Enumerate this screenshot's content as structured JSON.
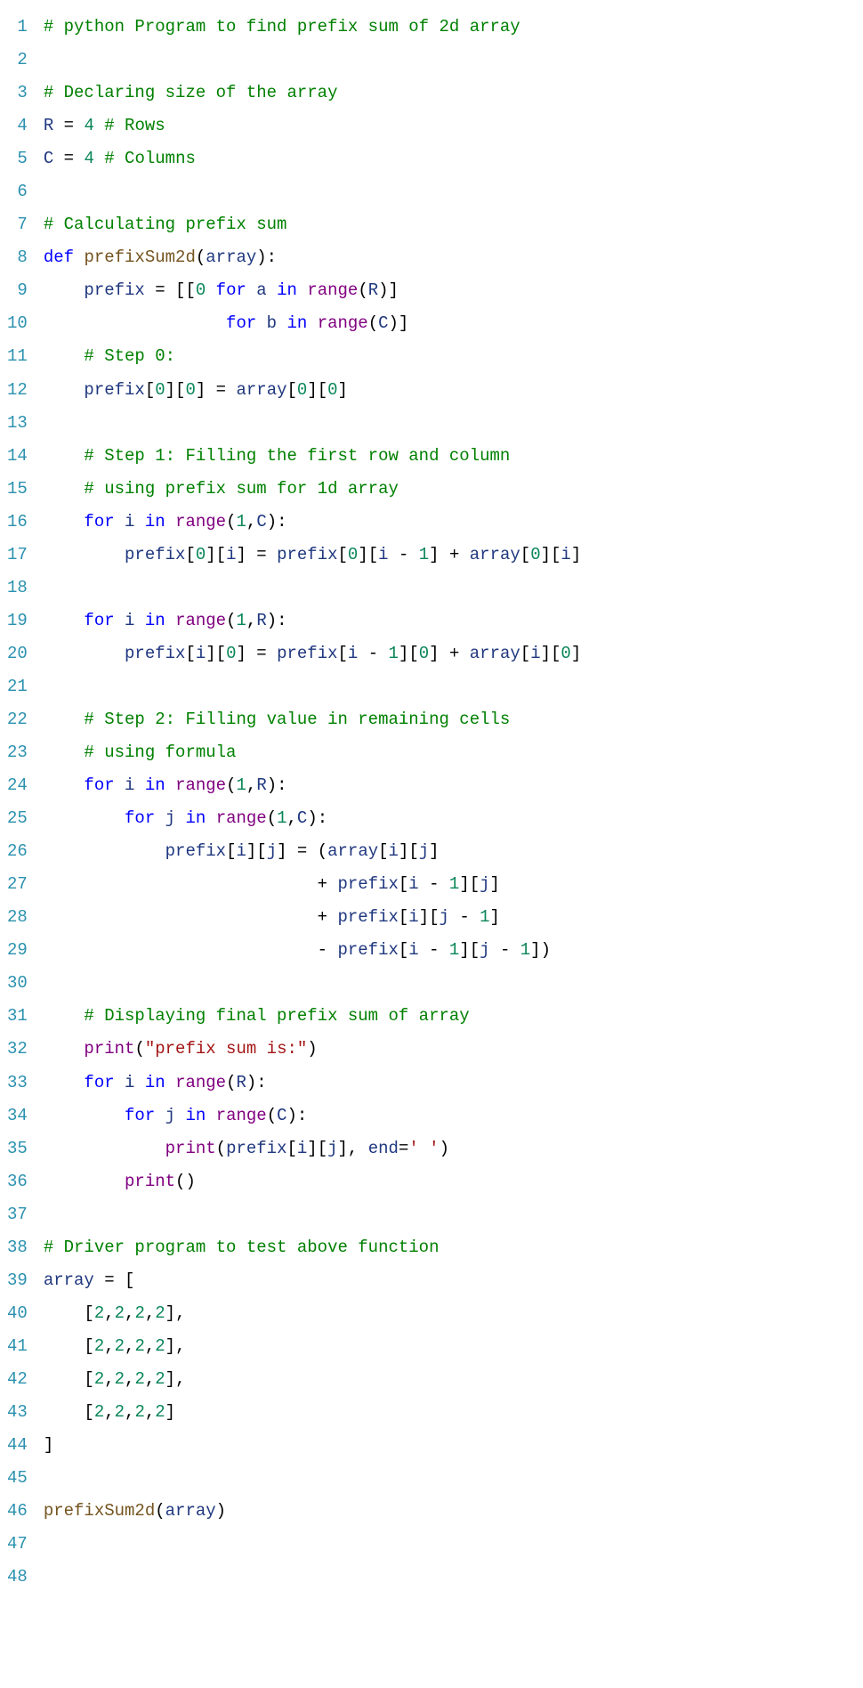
{
  "language": "python",
  "colors": {
    "comment": "#008000",
    "keyword": "#0000ff",
    "name": "#1f377f",
    "func": "#74531f",
    "number": "#098658",
    "builtin": "#800080",
    "string": "#a31515",
    "gutter": "#2b91af"
  },
  "line_count": 48,
  "code_lines": [
    "# python Program to find prefix sum of 2d array",
    "",
    "# Declaring size of the array",
    "R = 4 # Rows",
    "C = 4 # Columns",
    "",
    "# Calculating prefix sum",
    "def prefixSum2d(array):",
    "    prefix = [[0 for a in range(R)]",
    "                  for b in range(C)]",
    "    # Step 0:",
    "    prefix[0][0] = array[0][0]",
    "",
    "    # Step 1: Filling the first row and column",
    "    # using prefix sum for 1d array",
    "    for i in range(1,C):",
    "        prefix[0][i] = prefix[0][i - 1] + array[0][i]",
    "",
    "    for i in range(1,R):",
    "        prefix[i][0] = prefix[i - 1][0] + array[i][0]",
    "",
    "    # Step 2: Filling value in remaining cells",
    "    # using formula",
    "    for i in range(1,R):",
    "        for j in range(1,C):",
    "            prefix[i][j] = (array[i][j]",
    "                           + prefix[i - 1][j]",
    "                           + prefix[i][j - 1]",
    "                           - prefix[i - 1][j - 1])",
    "",
    "    # Displaying final prefix sum of array",
    "    print(\"prefix sum is:\")",
    "    for i in range(R):",
    "        for j in range(C):",
    "            print(prefix[i][j], end=' ')",
    "        print()",
    "",
    "# Driver program to test above function",
    "array = [",
    "    [2,2,2,2],",
    "    [2,2,2,2],",
    "    [2,2,2,2],",
    "    [2,2,2,2]",
    "]",
    "",
    "prefixSum2d(array)",
    "",
    ""
  ],
  "tokens": [
    [
      [
        "c",
        "# python Program to find prefix sum of 2d array"
      ]
    ],
    [],
    [
      [
        "c",
        "# Declaring size of the array"
      ]
    ],
    [
      [
        "nv",
        "R"
      ],
      [
        "p",
        " = "
      ],
      [
        "n1",
        "4"
      ],
      [
        "p",
        " "
      ],
      [
        "c",
        "# Rows"
      ]
    ],
    [
      [
        "nv",
        "C"
      ],
      [
        "p",
        " = "
      ],
      [
        "n1",
        "4"
      ],
      [
        "p",
        " "
      ],
      [
        "c",
        "# Columns"
      ]
    ],
    [],
    [
      [
        "c",
        "# Calculating prefix sum"
      ]
    ],
    [
      [
        "k",
        "def"
      ],
      [
        "p",
        " "
      ],
      [
        "fn",
        "prefixSum2d"
      ],
      [
        "p",
        "("
      ],
      [
        "nv",
        "array"
      ],
      [
        "p",
        "):"
      ]
    ],
    [
      [
        "p",
        "    "
      ],
      [
        "nv",
        "prefix"
      ],
      [
        "p",
        " = [["
      ],
      [
        "n0",
        "0"
      ],
      [
        "p",
        " "
      ],
      [
        "k",
        "for"
      ],
      [
        "p",
        " "
      ],
      [
        "nv",
        "a"
      ],
      [
        "p",
        " "
      ],
      [
        "k",
        "in"
      ],
      [
        "p",
        " "
      ],
      [
        "np",
        "range"
      ],
      [
        "p",
        "("
      ],
      [
        "nv",
        "R"
      ],
      [
        "p",
        ")]"
      ]
    ],
    [
      [
        "p",
        "                  "
      ],
      [
        "k",
        "for"
      ],
      [
        "p",
        " "
      ],
      [
        "nv",
        "b"
      ],
      [
        "p",
        " "
      ],
      [
        "k",
        "in"
      ],
      [
        "p",
        " "
      ],
      [
        "np",
        "range"
      ],
      [
        "p",
        "("
      ],
      [
        "nv",
        "C"
      ],
      [
        "p",
        ")]"
      ]
    ],
    [
      [
        "p",
        "    "
      ],
      [
        "c",
        "# Step 0:"
      ]
    ],
    [
      [
        "p",
        "    "
      ],
      [
        "nv",
        "prefix"
      ],
      [
        "p",
        "["
      ],
      [
        "n0",
        "0"
      ],
      [
        "p",
        "]["
      ],
      [
        "n0",
        "0"
      ],
      [
        "p",
        "] = "
      ],
      [
        "nv",
        "array"
      ],
      [
        "p",
        "["
      ],
      [
        "n0",
        "0"
      ],
      [
        "p",
        "]["
      ],
      [
        "n0",
        "0"
      ],
      [
        "p",
        "]"
      ]
    ],
    [],
    [
      [
        "p",
        "    "
      ],
      [
        "c",
        "# Step 1: Filling the first row and column"
      ]
    ],
    [
      [
        "p",
        "    "
      ],
      [
        "c",
        "# using prefix sum for 1d array"
      ]
    ],
    [
      [
        "p",
        "    "
      ],
      [
        "k",
        "for"
      ],
      [
        "p",
        " "
      ],
      [
        "nv",
        "i"
      ],
      [
        "p",
        " "
      ],
      [
        "k",
        "in"
      ],
      [
        "p",
        " "
      ],
      [
        "np",
        "range"
      ],
      [
        "p",
        "("
      ],
      [
        "n1",
        "1"
      ],
      [
        "p",
        ","
      ],
      [
        "nv",
        "C"
      ],
      [
        "p",
        "):"
      ]
    ],
    [
      [
        "p",
        "        "
      ],
      [
        "nv",
        "prefix"
      ],
      [
        "p",
        "["
      ],
      [
        "n0",
        "0"
      ],
      [
        "p",
        "]["
      ],
      [
        "nv",
        "i"
      ],
      [
        "p",
        "] = "
      ],
      [
        "nv",
        "prefix"
      ],
      [
        "p",
        "["
      ],
      [
        "n0",
        "0"
      ],
      [
        "p",
        "]["
      ],
      [
        "nv",
        "i"
      ],
      [
        "p",
        " - "
      ],
      [
        "n1",
        "1"
      ],
      [
        "p",
        "] + "
      ],
      [
        "nv",
        "array"
      ],
      [
        "p",
        "["
      ],
      [
        "n0",
        "0"
      ],
      [
        "p",
        "]["
      ],
      [
        "nv",
        "i"
      ],
      [
        "p",
        "]"
      ]
    ],
    [],
    [
      [
        "p",
        "    "
      ],
      [
        "k",
        "for"
      ],
      [
        "p",
        " "
      ],
      [
        "nv",
        "i"
      ],
      [
        "p",
        " "
      ],
      [
        "k",
        "in"
      ],
      [
        "p",
        " "
      ],
      [
        "np",
        "range"
      ],
      [
        "p",
        "("
      ],
      [
        "n1",
        "1"
      ],
      [
        "p",
        ","
      ],
      [
        "nv",
        "R"
      ],
      [
        "p",
        "):"
      ]
    ],
    [
      [
        "p",
        "        "
      ],
      [
        "nv",
        "prefix"
      ],
      [
        "p",
        "["
      ],
      [
        "nv",
        "i"
      ],
      [
        "p",
        "]["
      ],
      [
        "n0",
        "0"
      ],
      [
        "p",
        "] = "
      ],
      [
        "nv",
        "prefix"
      ],
      [
        "p",
        "["
      ],
      [
        "nv",
        "i"
      ],
      [
        "p",
        " - "
      ],
      [
        "n1",
        "1"
      ],
      [
        "p",
        "]["
      ],
      [
        "n0",
        "0"
      ],
      [
        "p",
        "] + "
      ],
      [
        "nv",
        "array"
      ],
      [
        "p",
        "["
      ],
      [
        "nv",
        "i"
      ],
      [
        "p",
        "]["
      ],
      [
        "n0",
        "0"
      ],
      [
        "p",
        "]"
      ]
    ],
    [],
    [
      [
        "p",
        "    "
      ],
      [
        "c",
        "# Step 2: Filling value in remaining cells"
      ]
    ],
    [
      [
        "p",
        "    "
      ],
      [
        "c",
        "# using formula"
      ]
    ],
    [
      [
        "p",
        "    "
      ],
      [
        "k",
        "for"
      ],
      [
        "p",
        " "
      ],
      [
        "nv",
        "i"
      ],
      [
        "p",
        " "
      ],
      [
        "k",
        "in"
      ],
      [
        "p",
        " "
      ],
      [
        "np",
        "range"
      ],
      [
        "p",
        "("
      ],
      [
        "n1",
        "1"
      ],
      [
        "p",
        ","
      ],
      [
        "nv",
        "R"
      ],
      [
        "p",
        "):"
      ]
    ],
    [
      [
        "p",
        "        "
      ],
      [
        "k",
        "for"
      ],
      [
        "p",
        " "
      ],
      [
        "nv",
        "j"
      ],
      [
        "p",
        " "
      ],
      [
        "k",
        "in"
      ],
      [
        "p",
        " "
      ],
      [
        "np",
        "range"
      ],
      [
        "p",
        "("
      ],
      [
        "n1",
        "1"
      ],
      [
        "p",
        ","
      ],
      [
        "nv",
        "C"
      ],
      [
        "p",
        "):"
      ]
    ],
    [
      [
        "p",
        "            "
      ],
      [
        "nv",
        "prefix"
      ],
      [
        "p",
        "["
      ],
      [
        "nv",
        "i"
      ],
      [
        "p",
        "]["
      ],
      [
        "nv",
        "j"
      ],
      [
        "p",
        "] = ("
      ],
      [
        "nv",
        "array"
      ],
      [
        "p",
        "["
      ],
      [
        "nv",
        "i"
      ],
      [
        "p",
        "]["
      ],
      [
        "nv",
        "j"
      ],
      [
        "p",
        "]"
      ]
    ],
    [
      [
        "p",
        "                           + "
      ],
      [
        "nv",
        "prefix"
      ],
      [
        "p",
        "["
      ],
      [
        "nv",
        "i"
      ],
      [
        "p",
        " - "
      ],
      [
        "n1",
        "1"
      ],
      [
        "p",
        "]["
      ],
      [
        "nv",
        "j"
      ],
      [
        "p",
        "]"
      ]
    ],
    [
      [
        "p",
        "                           + "
      ],
      [
        "nv",
        "prefix"
      ],
      [
        "p",
        "["
      ],
      [
        "nv",
        "i"
      ],
      [
        "p",
        "]["
      ],
      [
        "nv",
        "j"
      ],
      [
        "p",
        " - "
      ],
      [
        "n1",
        "1"
      ],
      [
        "p",
        "]"
      ]
    ],
    [
      [
        "p",
        "                           - "
      ],
      [
        "nv",
        "prefix"
      ],
      [
        "p",
        "["
      ],
      [
        "nv",
        "i"
      ],
      [
        "p",
        " - "
      ],
      [
        "n1",
        "1"
      ],
      [
        "p",
        "]["
      ],
      [
        "nv",
        "j"
      ],
      [
        "p",
        " - "
      ],
      [
        "n1",
        "1"
      ],
      [
        "p",
        "])"
      ]
    ],
    [],
    [
      [
        "p",
        "    "
      ],
      [
        "c",
        "# Displaying final prefix sum of array"
      ]
    ],
    [
      [
        "p",
        "    "
      ],
      [
        "np",
        "print"
      ],
      [
        "p",
        "("
      ],
      [
        "s",
        "\"prefix sum is:\""
      ],
      [
        "p",
        ")"
      ]
    ],
    [
      [
        "p",
        "    "
      ],
      [
        "k",
        "for"
      ],
      [
        "p",
        " "
      ],
      [
        "nv",
        "i"
      ],
      [
        "p",
        " "
      ],
      [
        "k",
        "in"
      ],
      [
        "p",
        " "
      ],
      [
        "np",
        "range"
      ],
      [
        "p",
        "("
      ],
      [
        "nv",
        "R"
      ],
      [
        "p",
        "):"
      ]
    ],
    [
      [
        "p",
        "        "
      ],
      [
        "k",
        "for"
      ],
      [
        "p",
        " "
      ],
      [
        "nv",
        "j"
      ],
      [
        "p",
        " "
      ],
      [
        "k",
        "in"
      ],
      [
        "p",
        " "
      ],
      [
        "np",
        "range"
      ],
      [
        "p",
        "("
      ],
      [
        "nv",
        "C"
      ],
      [
        "p",
        "):"
      ]
    ],
    [
      [
        "p",
        "            "
      ],
      [
        "np",
        "print"
      ],
      [
        "p",
        "("
      ],
      [
        "nv",
        "prefix"
      ],
      [
        "p",
        "["
      ],
      [
        "nv",
        "i"
      ],
      [
        "p",
        "]["
      ],
      [
        "nv",
        "j"
      ],
      [
        "p",
        "], "
      ],
      [
        "nv",
        "end"
      ],
      [
        "p",
        "="
      ],
      [
        "s",
        "' '"
      ],
      [
        "p",
        ")"
      ]
    ],
    [
      [
        "p",
        "        "
      ],
      [
        "np",
        "print"
      ],
      [
        "p",
        "()"
      ]
    ],
    [],
    [
      [
        "c",
        "# Driver program to test above function"
      ]
    ],
    [
      [
        "nv",
        "array"
      ],
      [
        "p",
        " = ["
      ]
    ],
    [
      [
        "p",
        "    ["
      ],
      [
        "n1",
        "2"
      ],
      [
        "p",
        ","
      ],
      [
        "n1",
        "2"
      ],
      [
        "p",
        ","
      ],
      [
        "n1",
        "2"
      ],
      [
        "p",
        ","
      ],
      [
        "n1",
        "2"
      ],
      [
        "p",
        "],"
      ]
    ],
    [
      [
        "p",
        "    ["
      ],
      [
        "n1",
        "2"
      ],
      [
        "p",
        ","
      ],
      [
        "n1",
        "2"
      ],
      [
        "p",
        ","
      ],
      [
        "n1",
        "2"
      ],
      [
        "p",
        ","
      ],
      [
        "n1",
        "2"
      ],
      [
        "p",
        "],"
      ]
    ],
    [
      [
        "p",
        "    ["
      ],
      [
        "n1",
        "2"
      ],
      [
        "p",
        ","
      ],
      [
        "n1",
        "2"
      ],
      [
        "p",
        ","
      ],
      [
        "n1",
        "2"
      ],
      [
        "p",
        ","
      ],
      [
        "n1",
        "2"
      ],
      [
        "p",
        "],"
      ]
    ],
    [
      [
        "p",
        "    ["
      ],
      [
        "n1",
        "2"
      ],
      [
        "p",
        ","
      ],
      [
        "n1",
        "2"
      ],
      [
        "p",
        ","
      ],
      [
        "n1",
        "2"
      ],
      [
        "p",
        ","
      ],
      [
        "n1",
        "2"
      ],
      [
        "p",
        "]"
      ]
    ],
    [
      [
        "p",
        "]"
      ]
    ],
    [],
    [
      [
        "fn",
        "prefixSum2d"
      ],
      [
        "p",
        "("
      ],
      [
        "nv",
        "array"
      ],
      [
        "p",
        ")"
      ]
    ],
    [],
    []
  ]
}
